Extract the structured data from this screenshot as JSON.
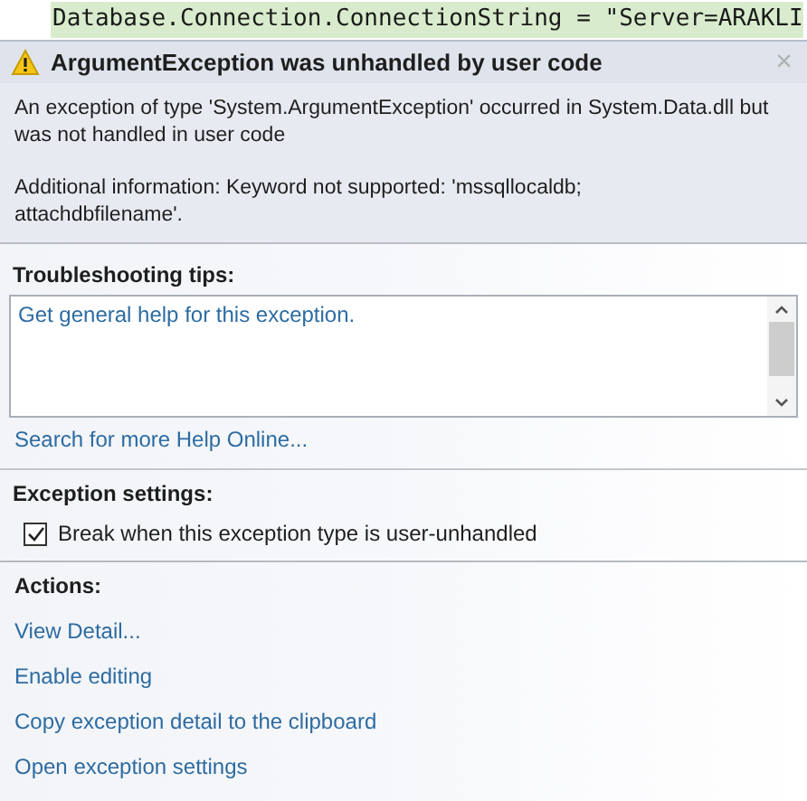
{
  "code_line": "Database.Connection.ConnectionString = \"Server=ARAKLI",
  "header": {
    "title": "ArgumentException was unhandled by user code",
    "close": "×"
  },
  "message": "An exception of type 'System.ArgumentException' occurred in System.Data.dll but was not handled in user code",
  "additional_info": "Additional information: Keyword not supported: 'mssqllocaldb; attachdbfilename'.",
  "troubleshooting": {
    "heading": "Troubleshooting tips:",
    "tips": [
      "Get general help for this exception."
    ],
    "search_link": "Search for more Help Online..."
  },
  "exception_settings": {
    "heading": "Exception settings:",
    "checkbox": {
      "label": "Break when this exception type is user-unhandled",
      "checked": true
    }
  },
  "actions": {
    "heading": "Actions:",
    "links": [
      "View Detail...",
      "Enable editing",
      "Copy exception detail to the clipboard",
      "Open exception settings"
    ]
  }
}
